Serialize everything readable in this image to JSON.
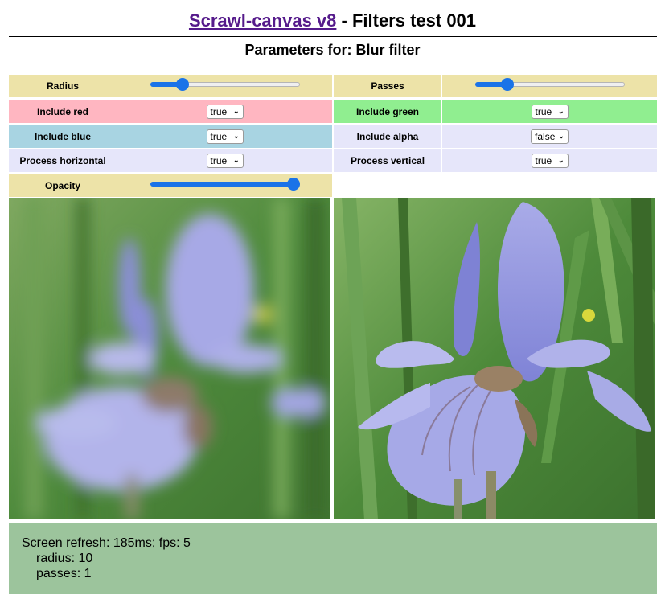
{
  "header": {
    "title_link": "Scrawl-canvas v8",
    "title_rest": " - Filters test 001",
    "subtitle": "Parameters for: Blur filter"
  },
  "controls": {
    "radius": {
      "label": "Radius",
      "value_fraction": 0.19
    },
    "passes": {
      "label": "Passes",
      "value_fraction": 0.19
    },
    "include_red": {
      "label": "Include red",
      "value": "true"
    },
    "include_green": {
      "label": "Include green",
      "value": "true"
    },
    "include_blue": {
      "label": "Include blue",
      "value": "true"
    },
    "include_alpha": {
      "label": "Include alpha",
      "value": "false"
    },
    "process_horizontal": {
      "label": "Process horizontal",
      "value": "true"
    },
    "process_vertical": {
      "label": "Process vertical",
      "value": "true"
    },
    "opacity": {
      "label": "Opacity",
      "value_fraction": 1.0
    }
  },
  "images": {
    "blurred": {
      "description": "blurred iris flower image"
    },
    "original": {
      "description": "iris flower image"
    }
  },
  "status": {
    "refresh": "Screen refresh: 185ms; fps: 5",
    "radius": "radius: 10",
    "passes": "passes: 1"
  },
  "colors": {
    "label_yellow": "#ede3a8",
    "red_row": "#ffb6c1",
    "green_row": "#90ee90",
    "blue_row": "#a8d4e2",
    "lavender_row": "#e6e6fa",
    "status_bg": "#9cc49c",
    "slider_accent": "#1a73e8"
  }
}
